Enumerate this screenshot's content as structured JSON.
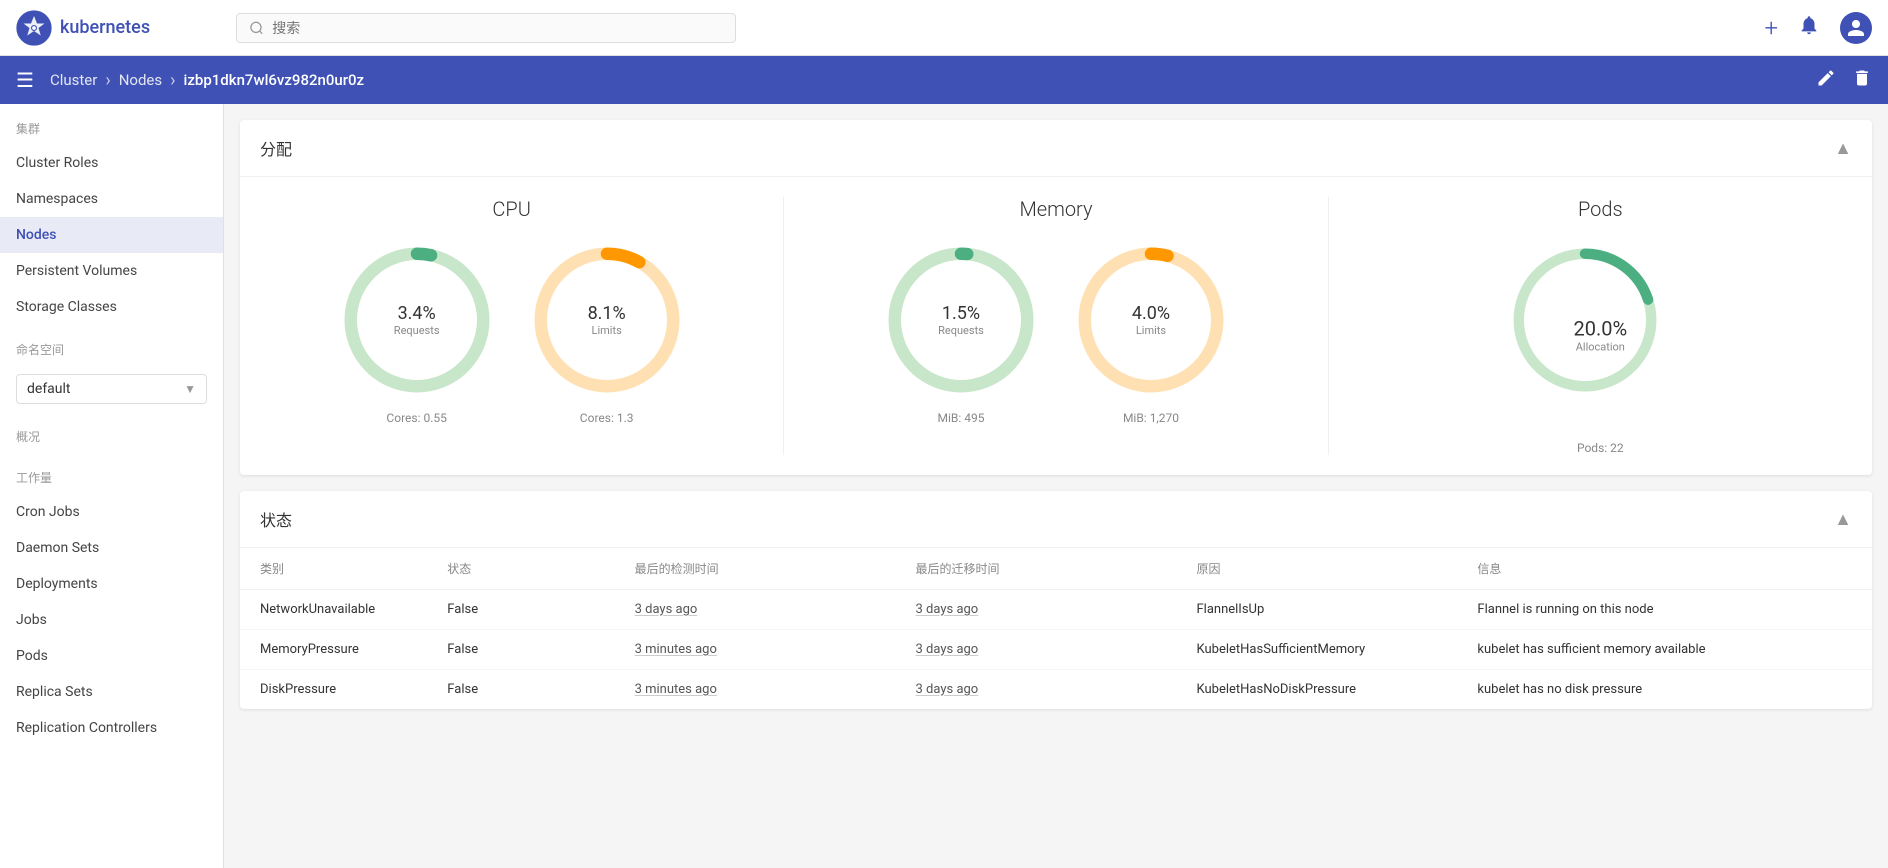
{
  "topNav": {
    "logoText": "kubernetes",
    "searchPlaceholder": "搜索"
  },
  "breadcrumb": {
    "menuIcon": "☰",
    "cluster": "Cluster",
    "nodes": "Nodes",
    "currentNode": "izbp1dkn7wl6vz982n0ur0z"
  },
  "sidebar": {
    "sections": [
      {
        "label": "集群",
        "items": [
          {
            "id": "cluster-roles",
            "label": "Cluster Roles",
            "active": false
          },
          {
            "id": "namespaces",
            "label": "Namespaces",
            "active": false
          },
          {
            "id": "nodes",
            "label": "Nodes",
            "active": true
          },
          {
            "id": "persistent-volumes",
            "label": "Persistent Volumes",
            "active": false
          },
          {
            "id": "storage-classes",
            "label": "Storage Classes",
            "active": false
          }
        ]
      },
      {
        "label": "命名空间",
        "items": []
      },
      {
        "label": "概况",
        "items": []
      },
      {
        "label": "工作量",
        "items": [
          {
            "id": "cron-jobs",
            "label": "Cron Jobs",
            "active": false
          },
          {
            "id": "daemon-sets",
            "label": "Daemon Sets",
            "active": false
          },
          {
            "id": "deployments",
            "label": "Deployments",
            "active": false
          },
          {
            "id": "jobs",
            "label": "Jobs",
            "active": false
          },
          {
            "id": "pods",
            "label": "Pods",
            "active": false
          },
          {
            "id": "replica-sets",
            "label": "Replica Sets",
            "active": false
          },
          {
            "id": "replication-controllers",
            "label": "Replication Controllers",
            "active": false
          }
        ]
      }
    ],
    "namespaceDefault": "default"
  },
  "allocationSection": {
    "title": "分配",
    "collapseIcon": "▲",
    "cpu": {
      "title": "CPU",
      "charts": [
        {
          "id": "cpu-requests",
          "percent": "3.4%",
          "label": "Requests",
          "footer": "Cores: 0.55",
          "value": 3.4,
          "color": "#4caf82",
          "trackColor": "#c8e6c9"
        },
        {
          "id": "cpu-limits",
          "percent": "8.1%",
          "label": "Limits",
          "footer": "Cores: 1.3",
          "value": 8.1,
          "color": "#ff9800",
          "trackColor": "#ffe0b2"
        }
      ]
    },
    "memory": {
      "title": "Memory",
      "charts": [
        {
          "id": "memory-requests",
          "percent": "1.5%",
          "label": "Requests",
          "footer": "MiB: 495",
          "value": 1.5,
          "color": "#4caf82",
          "trackColor": "#c8e6c9"
        },
        {
          "id": "memory-limits",
          "percent": "4.0%",
          "label": "Limits",
          "footer": "MiB: 1,270",
          "value": 4.0,
          "color": "#ff9800",
          "trackColor": "#ffe0b2"
        }
      ]
    },
    "pods": {
      "title": "Pods",
      "charts": [
        {
          "id": "pods-allocation",
          "percent": "20.0%",
          "label": "Allocation",
          "footer": "Pods: 22",
          "value": 20.0,
          "color": "#4caf82",
          "trackColor": "#c8e6c9"
        }
      ]
    }
  },
  "statusSection": {
    "title": "状态",
    "collapseIcon": "▲",
    "columns": [
      "类别",
      "状态",
      "最后的检测时间",
      "最后的迁移时间",
      "原因",
      "信息"
    ],
    "rows": [
      {
        "type": "NetworkUnavailable",
        "status": "False",
        "lastProbe": "3 days ago",
        "lastTransition": "3 days ago",
        "reason": "FlannelIsUp",
        "message": "Flannel is running on this node"
      },
      {
        "type": "MemoryPressure",
        "status": "False",
        "lastProbe": "3 minutes ago",
        "lastTransition": "3 days ago",
        "reason": "KubeletHasSufficientMemory",
        "message": "kubelet has sufficient memory available"
      },
      {
        "type": "DiskPressure",
        "status": "False",
        "lastProbe": "3 minutes ago",
        "lastTransition": "3 days ago",
        "reason": "KubeletHasNoDiskPressure",
        "message": "kubelet has no disk pressure"
      }
    ]
  }
}
